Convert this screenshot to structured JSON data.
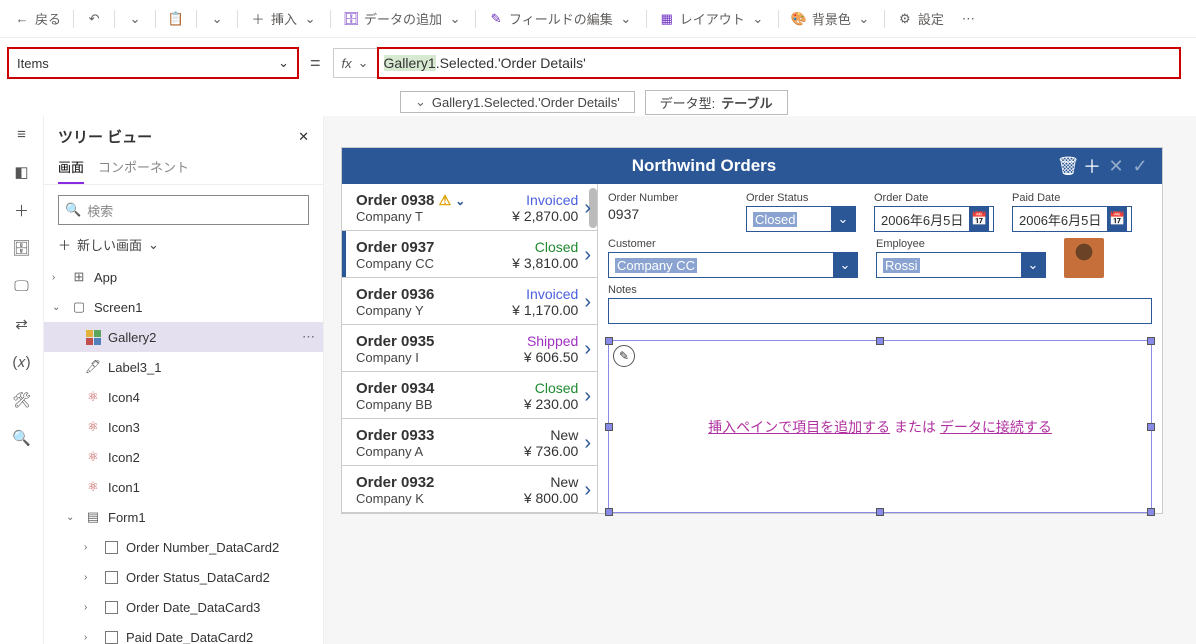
{
  "cmdbar": {
    "back": "戻る",
    "insert": "挿入",
    "addData": "データの追加",
    "editFields": "フィールドの編集",
    "layout": "レイアウト",
    "bgcolor": "背景色",
    "settings": "設定"
  },
  "formula": {
    "property": "Items",
    "fx": "fx",
    "tok_gallery": "Gallery1",
    "tok_rest": ".Selected.'Order Details'",
    "result_expr": "Gallery1.Selected.'Order Details'",
    "result_type_label": "データ型:",
    "result_type": "テーブル"
  },
  "tree": {
    "title": "ツリー ビュー",
    "tabs": {
      "screen": "画面",
      "components": "コンポーネント"
    },
    "search_ph": "検索",
    "newScreen": "新しい画面",
    "nodes": {
      "app": "App",
      "screen1": "Screen1",
      "gallery2": "Gallery2",
      "label3_1": "Label3_1",
      "icon4": "Icon4",
      "icon3": "Icon3",
      "icon2": "Icon2",
      "icon1": "Icon1",
      "form1": "Form1",
      "dc_ordernum": "Order Number_DataCard2",
      "dc_status": "Order Status_DataCard2",
      "dc_orderdate": "Order Date_DataCard3",
      "dc_paiddate": "Paid Date_DataCard2"
    }
  },
  "app": {
    "title": "Northwind Orders",
    "orders": [
      {
        "num": "Order 0938",
        "company": "Company T",
        "status": "Invoiced",
        "statusClass": "sInvoiced",
        "amount": "¥ 2,870.00",
        "warn": true
      },
      {
        "num": "Order 0937",
        "company": "Company CC",
        "status": "Closed",
        "statusClass": "sClosed",
        "amount": "¥ 3,810.00",
        "selected": true
      },
      {
        "num": "Order 0936",
        "company": "Company Y",
        "status": "Invoiced",
        "statusClass": "sInvoiced",
        "amount": "¥ 1,170.00"
      },
      {
        "num": "Order 0935",
        "company": "Company I",
        "status": "Shipped",
        "statusClass": "sShipped",
        "amount": "¥ 606.50"
      },
      {
        "num": "Order 0934",
        "company": "Company BB",
        "status": "Closed",
        "statusClass": "sClosed",
        "amount": "¥ 230.00"
      },
      {
        "num": "Order 0933",
        "company": "Company A",
        "status": "New",
        "statusClass": "sNew",
        "amount": "¥ 736.00"
      },
      {
        "num": "Order 0932",
        "company": "Company K",
        "status": "New",
        "statusClass": "sNew",
        "amount": "¥ 800.00"
      }
    ],
    "detail": {
      "order_number_lbl": "Order Number",
      "order_number": "0937",
      "order_status_lbl": "Order Status",
      "order_status": "Closed",
      "order_date_lbl": "Order Date",
      "order_date": "2006年6月5日",
      "paid_date_lbl": "Paid Date",
      "paid_date": "2006年6月5日",
      "customer_lbl": "Customer",
      "customer": "Company CC",
      "employee_lbl": "Employee",
      "employee": "Rossi",
      "notes_lbl": "Notes"
    },
    "placeholder": {
      "part1": "挿入ペインで項目を追加する",
      "mid": " または ",
      "part2": "データに接続する"
    }
  }
}
